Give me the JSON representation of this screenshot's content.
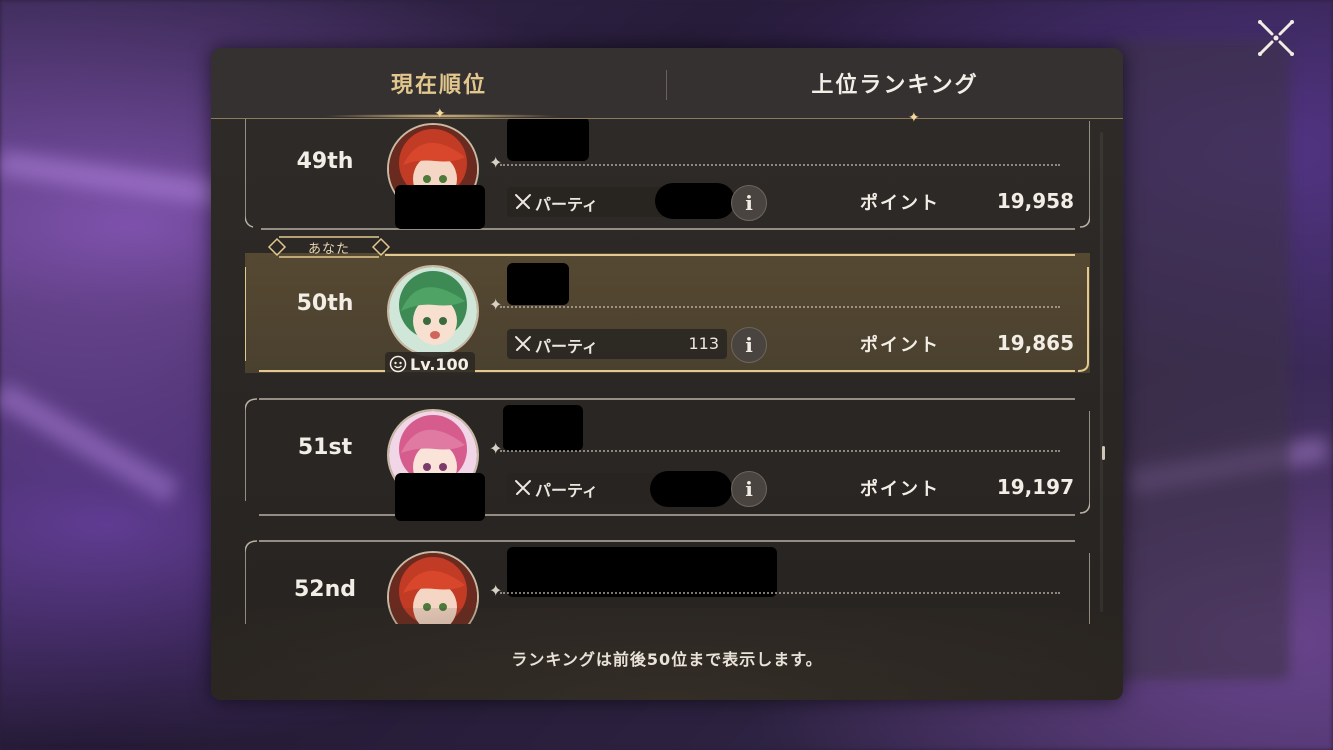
{
  "tabs": [
    {
      "label": "現在順位",
      "active": true
    },
    {
      "label": "上位ランキング",
      "active": false
    }
  ],
  "you_label": "あなた",
  "party_label": "パーティ",
  "points_label": "ポイント",
  "rows": [
    {
      "rank": "49th",
      "party_value": "",
      "points": "19,958",
      "is_you": false,
      "avatar": "red-hair"
    },
    {
      "rank": "50th",
      "party_value": "113",
      "points": "19,865",
      "is_you": true,
      "level": "Lv.100",
      "avatar": "green-hair"
    },
    {
      "rank": "51st",
      "party_value": "",
      "points": "19,197",
      "is_you": false,
      "avatar": "pink-hair"
    },
    {
      "rank": "52nd",
      "party_value": "",
      "points": "",
      "is_you": false,
      "avatar": "red-hair"
    }
  ],
  "footer_note": "ランキングは前後50位まで表示します。",
  "icons": {
    "close": "close-x-icon",
    "party": "crossed-swords-icon",
    "info": "info-icon",
    "level": "level-face-icon"
  },
  "colors": {
    "active_tab": "#e2c78e",
    "gold_frame": "#d9bf86",
    "highlight_row": "#6e6140"
  }
}
